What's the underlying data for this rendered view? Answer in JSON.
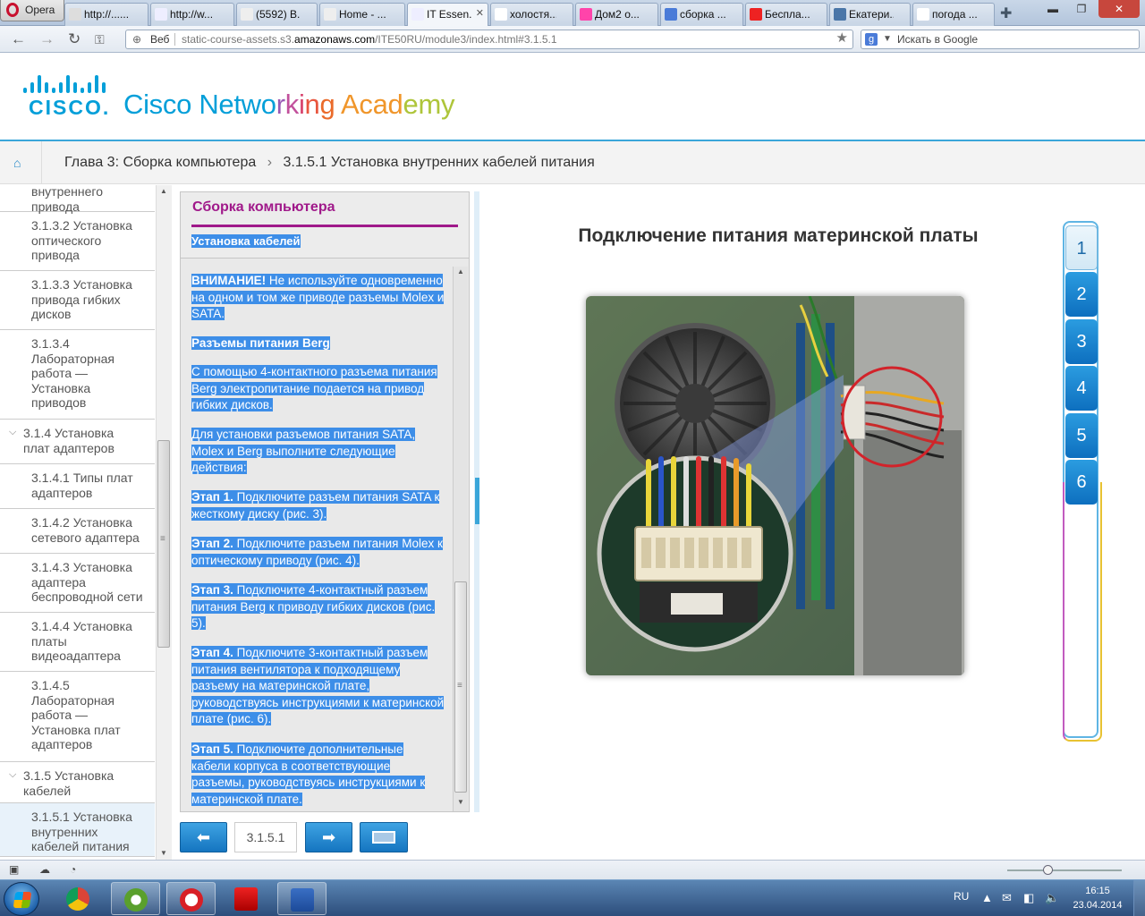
{
  "browser": {
    "menu_label": "Opera",
    "tabs": [
      {
        "label": "http://......",
        "icon": "opera-link-icon",
        "active": false
      },
      {
        "label": "http://w...",
        "icon": "page-icon",
        "active": false
      },
      {
        "label": "(5592) В...",
        "icon": "mail-icon",
        "active": false
      },
      {
        "label": "Home - ...",
        "icon": "cisco-icon",
        "active": false
      },
      {
        "label": "IT Essen...",
        "icon": "page-icon",
        "active": true
      },
      {
        "label": "холостя...",
        "icon": "yandex-icon",
        "active": false
      },
      {
        "label": "Дом2 о...",
        "icon": "flower-icon",
        "active": false
      },
      {
        "label": "сборка ...",
        "icon": "google-icon",
        "active": false
      },
      {
        "label": "Бесплa...",
        "icon": "youtube-icon",
        "active": false
      },
      {
        "label": "Екатери...",
        "icon": "vk-icon",
        "active": false
      },
      {
        "label": "погода ...",
        "icon": "yandex-icon",
        "active": false
      }
    ],
    "address": {
      "scheme_label": "Веб",
      "url_pre": "static-course-assets.s3.",
      "url_domain": "amazonaws.com",
      "url_post": "/ITE50RU/module3/index.html#3.1.5.1"
    },
    "search_placeholder": "Искать в Google"
  },
  "header": {
    "cisco_word": "CISCO.",
    "academy_parts": [
      {
        "text": "Cisco ",
        "color": "#049fd9"
      },
      {
        "text": "Netwo",
        "color": "#049fd9"
      },
      {
        "text": "r",
        "color": "#9a59b5"
      },
      {
        "text": "k",
        "color": "#c2509c"
      },
      {
        "text": "i",
        "color": "#d8446e"
      },
      {
        "text": "n",
        "color": "#e8563f"
      },
      {
        "text": "g ",
        "color": "#ea6b2b"
      },
      {
        "text": "Acad",
        "color": "#f0962b"
      },
      {
        "text": "emy",
        "color": "#aec53a"
      }
    ]
  },
  "breadcrumb": {
    "chapter": "Глава 3: Сборка компьютера",
    "separator": "›",
    "page": "3.1.5.1 Установка внутренних кабелей питания"
  },
  "sidebar": {
    "items": [
      {
        "text": "внутреннего\nпривода",
        "kind": "sub"
      },
      {
        "text": "3.1.3.2 Установка\nоптического\nпривода",
        "kind": "sub"
      },
      {
        "text": "3.1.3.3 Установка\nпривода гибких\nдисков",
        "kind": "sub"
      },
      {
        "text": "3.1.3.4\nЛабораторная\nработа —\nУстановка\nприводов",
        "kind": "sub"
      },
      {
        "text": "3.1.4 Установка\nплат адаптеров",
        "kind": "sec"
      },
      {
        "text": "3.1.4.1 Типы плат\nадаптеров",
        "kind": "sub"
      },
      {
        "text": "3.1.4.2 Установка\nсетевого адаптера",
        "kind": "sub"
      },
      {
        "text": "3.1.4.3 Установка\nадаптера\nбеспроводной сети",
        "kind": "sub"
      },
      {
        "text": "3.1.4.4 Установка\nплаты\nвидеоадаптера",
        "kind": "sub"
      },
      {
        "text": "3.1.4.5\nЛабораторная\nработа —\nУстановка плат\nадаптеров",
        "kind": "sub"
      },
      {
        "text": "3.1.5 Установка\nкабелей",
        "kind": "sec"
      },
      {
        "text": "3.1.5.1 Установка\nвнутренних\nкабелей питания",
        "kind": "cur"
      }
    ]
  },
  "text_panel": {
    "title": "Сборка компьютера",
    "subtitle": "Установка кабелей",
    "paragraphs": [
      {
        "bold": "ВНИМАНИЕ!",
        "text": " Не используйте одновременно на одном и том же приводе разъемы Molex и SATA."
      },
      {
        "bold": "Разъемы питания Berg",
        "text": ""
      },
      {
        "bold": "",
        "text": "С помощью 4-контактного разъема питания Berg электропитание подается на привод гибких дисков."
      },
      {
        "bold": "",
        "text": "Для установки разъемов питания SATA, Molex и Berg выполните следующие действия:"
      },
      {
        "bold": "Этап 1.",
        "text": " Подключите разъем питания SATA к жесткому диску (рис. 3)."
      },
      {
        "bold": "Этап 2.",
        "text": " Подключите разъем питания Molex к оптическому приводу (рис. 4)."
      },
      {
        "bold": "Этап 3.",
        "text": " Подключите 4-контактный разъем питания Berg к приводу гибких дисков (рис. 5)."
      },
      {
        "bold": "Этап 4.",
        "text": " Подключите 3-контактный разъем питания вентилятора к подходящему разъему на материнской плате, руководствуясь инструкциями к материнской плате (рис. 6)."
      },
      {
        "bold": "Этап 5.",
        "text": " Подключите дополнительные кабели корпуса в соответствующие разъемы, руководствуясь инструкциями к материнской плате."
      }
    ]
  },
  "pager": {
    "page_label": "3.1.5.1"
  },
  "figure": {
    "title": "Подключение питания материнской платы"
  },
  "steps": [
    "1",
    "2",
    "3",
    "4",
    "5",
    "6"
  ],
  "taskbar": {
    "apps": [
      {
        "name": "chrome-icon",
        "open": false
      },
      {
        "name": "utorrent-icon",
        "open": true
      },
      {
        "name": "opera-icon",
        "open": true
      },
      {
        "name": "pdf-reader-icon",
        "open": false
      },
      {
        "name": "word-icon",
        "open": true
      }
    ],
    "language": "RU",
    "time": "16:15",
    "date": "23.04.2014"
  },
  "colors": {
    "accent": "#049fd9",
    "magenta": "#a0198a",
    "selection": "#3d8ee8",
    "button": "#1a7fcf"
  }
}
